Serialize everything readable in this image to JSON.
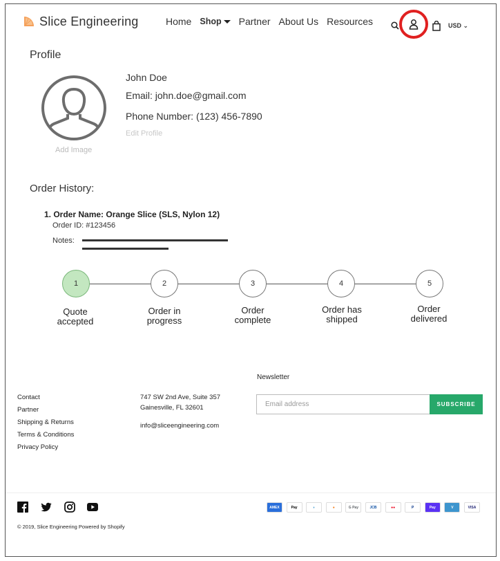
{
  "header": {
    "brand": "Slice Engineering",
    "nav": [
      "Home",
      "Shop",
      "Partner",
      "About Us",
      "Resources"
    ],
    "currency": "USD"
  },
  "profile": {
    "title": "Profile",
    "add_image": "Add Image",
    "name": "John Doe",
    "email": "Email: john.doe@gmail.com",
    "phone": "Phone Number: (123) 456-7890",
    "edit": "Edit Profile"
  },
  "orders": {
    "title": "Order History:",
    "items": [
      {
        "name": "1. Order Name: Orange Slice (SLS, Nylon 12)",
        "id": "Order ID: #123456",
        "notes_label": "Notes:"
      }
    ],
    "steps": [
      {
        "num": "1",
        "label_l1": "Quote",
        "label_l2": "accepted",
        "completed": true
      },
      {
        "num": "2",
        "label_l1": "Order in",
        "label_l2": "progress",
        "completed": false
      },
      {
        "num": "3",
        "label_l1": "Order",
        "label_l2": "complete",
        "completed": false
      },
      {
        "num": "4",
        "label_l1": "Order has",
        "label_l2": "shipped",
        "completed": false
      },
      {
        "num": "5",
        "label_l1": "Order",
        "label_l2": "delivered",
        "completed": false
      }
    ]
  },
  "footer": {
    "links": [
      "Contact",
      "Partner",
      "Shipping & Returns",
      "Terms & Conditions",
      "Privacy Policy"
    ],
    "address_l1": "747 SW 2nd Ave, Suite 357",
    "address_l2": "Gainesville, FL 32601",
    "email": "info@sliceengineering.com",
    "newsletter_title": "Newsletter",
    "email_placeholder": "Email address",
    "subscribe": "SUBSCRIBE",
    "copyright": "© 2019, Slice Engineering Powered by Shopify",
    "social_icons": [
      "facebook-icon",
      "twitter-icon",
      "instagram-icon",
      "youtube-icon"
    ],
    "payments": [
      {
        "label": "AMEX",
        "bg": "#2a6fdb",
        "fg": "#ffffff"
      },
      {
        "label": "Pay",
        "bg": "#ffffff",
        "fg": "#000000"
      },
      {
        "label": "◗",
        "bg": "#ffffff",
        "fg": "#0079be"
      },
      {
        "label": "●",
        "bg": "#ffffff",
        "fg": "#f58220"
      },
      {
        "label": "G Pay",
        "bg": "#ffffff",
        "fg": "#5f6368"
      },
      {
        "label": "JCB",
        "bg": "#ffffff",
        "fg": "#0b4ea2"
      },
      {
        "label": "●●",
        "bg": "#ffffff",
        "fg": "#eb001b"
      },
      {
        "label": "P",
        "bg": "#ffffff",
        "fg": "#003087"
      },
      {
        "label": "Pay",
        "bg": "#5a31f4",
        "fg": "#ffffff"
      },
      {
        "label": "V",
        "bg": "#3d95ce",
        "fg": "#ffffff"
      },
      {
        "label": "VISA",
        "bg": "#ffffff",
        "fg": "#1a1f71"
      }
    ]
  },
  "colors": {
    "accent_green": "#27a86a",
    "step_done": "#c3e7c0",
    "highlight_red": "#e02020"
  }
}
